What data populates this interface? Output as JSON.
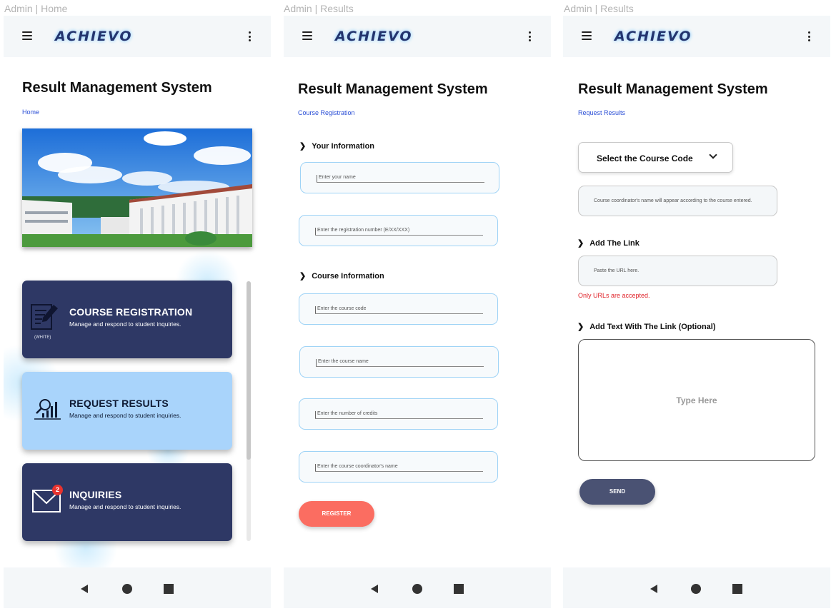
{
  "screens": [
    {
      "label": "Admin | Home",
      "app_name": "ACHIEVO",
      "title": "Result Management System",
      "breadcrumb": "Home"
    },
    {
      "label": "Admin | Results",
      "app_name": "ACHIEVO",
      "title": "Result Management System",
      "breadcrumb": "Course Registration"
    },
    {
      "label": "Admin | Results",
      "app_name": "ACHIEVO",
      "title": "Result Management System",
      "breadcrumb": "Request Results"
    }
  ],
  "home": {
    "cards": [
      {
        "title": "COURSE REGISTRATION",
        "subtitle": "Manage and respond to student inquiries.",
        "icon": "document-edit-icon",
        "icon_note": "(WHITE)"
      },
      {
        "title": "REQUEST RESULTS",
        "subtitle": "Manage and respond to student inquiries.",
        "icon": "chart-search-icon"
      },
      {
        "title": "INQUIRIES",
        "subtitle": "Manage and respond to student inquiries.",
        "icon": "mail-icon",
        "badge": "2"
      }
    ]
  },
  "registration": {
    "your_info_label": "Your Information",
    "course_info_label": "Course Information",
    "fields": {
      "name": "Enter your name",
      "reg_no": "Enter the registration number (E/XX/XXX)",
      "course_code": "Enter the course code",
      "course_name": "Enter the course name",
      "credits": "Enter the number of credits",
      "coordinator": "Enter the course coordinator's name"
    },
    "register_label": "REGISTER"
  },
  "request": {
    "select_label": "Select the Course Code",
    "coordinator_info": "Course coordinator's name will appear according to the course entered.",
    "add_link_label": "Add The Link",
    "url_placeholder": "Paste the URL here.",
    "url_error": "Only URLs are accepted.",
    "add_text_label": "Add Text With The Link (Optional)",
    "text_placeholder": "Type Here",
    "send_label": "SEND"
  },
  "colors": {
    "brand": "#23346e",
    "card_dark": "#2e3865",
    "card_light": "#a9d4fb",
    "register": "#fb6d61",
    "send": "#4a5273",
    "link": "#2b4fd6",
    "error": "#e0242b"
  }
}
